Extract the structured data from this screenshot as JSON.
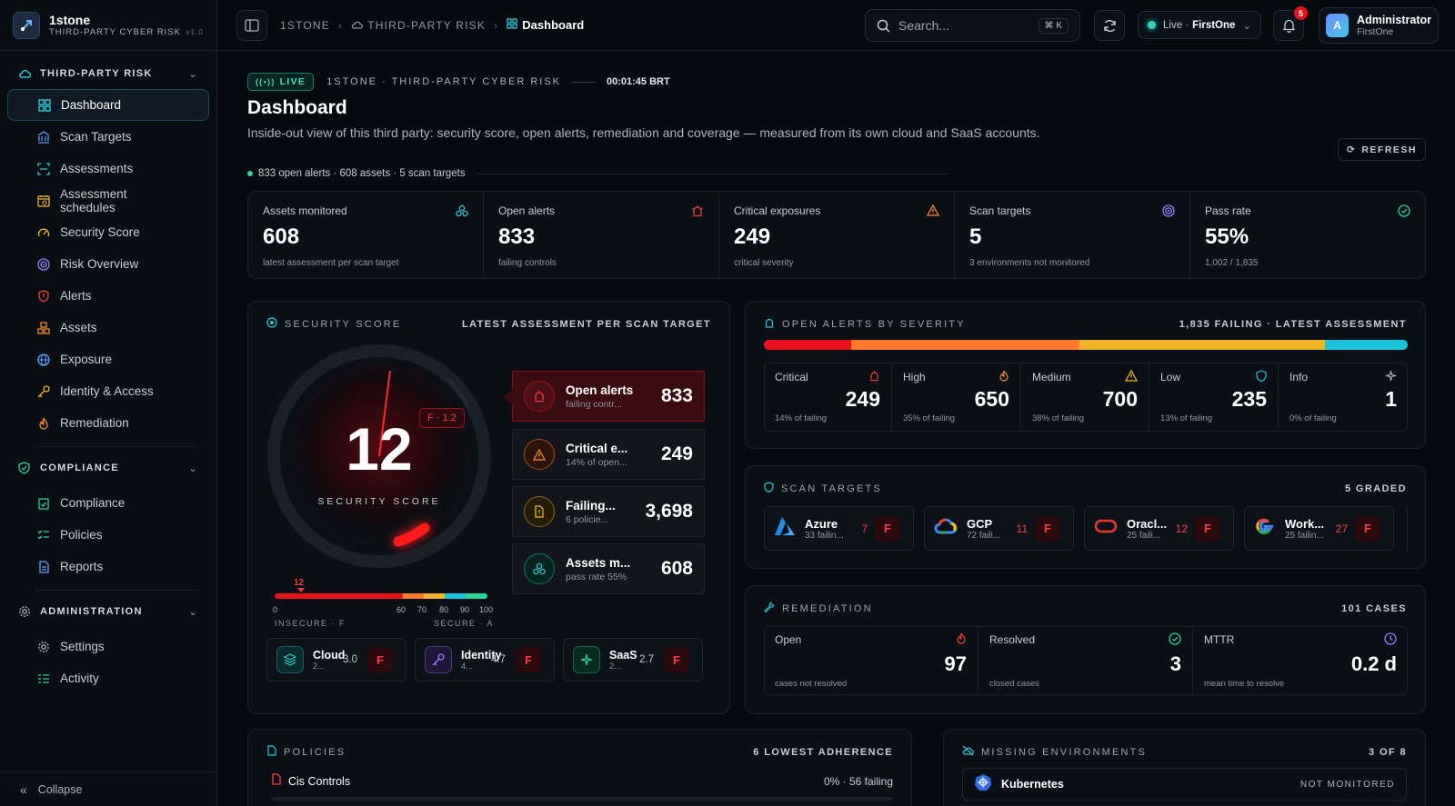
{
  "brand": {
    "name": "1stone",
    "subtitle": "THIRD-PARTY CYBER RISK",
    "version": "v1.0"
  },
  "sidebar": {
    "sections": [
      {
        "title": "THIRD-PARTY RISK",
        "items": [
          {
            "label": "Dashboard",
            "icon": "dashboard-icon",
            "active": true
          },
          {
            "label": "Scan Targets",
            "icon": "bank-icon"
          },
          {
            "label": "Assessments",
            "icon": "scan-icon"
          },
          {
            "label": "Assessment schedules",
            "icon": "calendar-clock-icon"
          },
          {
            "label": "Security Score",
            "icon": "gauge-icon"
          },
          {
            "label": "Risk Overview",
            "icon": "radar-icon"
          },
          {
            "label": "Alerts",
            "icon": "shield-alert-icon"
          },
          {
            "label": "Assets",
            "icon": "boxes-icon"
          },
          {
            "label": "Exposure",
            "icon": "globe-icon"
          },
          {
            "label": "Identity & Access",
            "icon": "key-icon"
          },
          {
            "label": "Remediation",
            "icon": "flame-icon"
          }
        ]
      },
      {
        "title": "COMPLIANCE",
        "items": [
          {
            "label": "Compliance",
            "icon": "clipboard-check-icon"
          },
          {
            "label": "Policies",
            "icon": "list-checks-icon"
          },
          {
            "label": "Reports",
            "icon": "file-text-icon"
          }
        ]
      },
      {
        "title": "ADMINISTRATION",
        "items": [
          {
            "label": "Settings",
            "icon": "gear-icon"
          },
          {
            "label": "Activity",
            "icon": "activity-list-icon"
          }
        ]
      }
    ],
    "collapse_label": "Collapse"
  },
  "topbar": {
    "breadcrumb": [
      "1STONE",
      "THIRD-PARTY RISK",
      "Dashboard"
    ],
    "search_placeholder": "Search...",
    "search_shortcut": "⌘ K",
    "env_status": "Live ·",
    "env_name": "FirstOne",
    "notifications": "5",
    "user_initial": "A",
    "user_name": "Administrator",
    "user_org": "FirstOne"
  },
  "header": {
    "live": "LIVE",
    "context": "1STONE · THIRD-PARTY CYBER RISK",
    "time": "00:01:45 BRT",
    "title": "Dashboard",
    "description": "Inside-out view of this third party: security score, open alerts, remediation and coverage — measured from its own cloud and SaaS accounts.",
    "stats": "833 open alerts · 608 assets · 5 scan targets",
    "refresh": "REFRESH"
  },
  "kpis": [
    {
      "label": "Assets monitored",
      "value": "608",
      "sub": "latest assessment per scan target",
      "icon": "boxes-icon",
      "color": "#2ec8d8"
    },
    {
      "label": "Open alerts",
      "value": "833",
      "sub": "failing controls",
      "icon": "siren-icon",
      "color": "#ff3b3b"
    },
    {
      "label": "Critical exposures",
      "value": "249",
      "sub": "critical severity",
      "icon": "warning-icon",
      "color": "#ff8a2a"
    },
    {
      "label": "Scan targets",
      "value": "5",
      "sub": "3 environments not monitored",
      "icon": "target-icon",
      "color": "#9a7dff"
    },
    {
      "label": "Pass rate",
      "value": "55%",
      "sub": "1,002 / 1,835",
      "icon": "check-circle-icon",
      "color": "#2ed39a"
    }
  ],
  "security_score": {
    "title": "SECURITY SCORE",
    "right": "LATEST ASSESSMENT PER SCAN TARGET",
    "score": "12",
    "score_label": "SECURITY SCORE",
    "grade": "F · 1.2",
    "bar_marker": "12",
    "ticks": [
      "0",
      "60",
      "70",
      "80",
      "90",
      "100"
    ],
    "insecure": "INSECURE · F",
    "secure": "SECURE · A",
    "metrics": [
      {
        "title": "Open alerts",
        "sub": "failing contr...",
        "value": "833"
      },
      {
        "title": "Critical e...",
        "sub": "14% of open...",
        "value": "249"
      },
      {
        "title": "Failing...",
        "sub": "6 policie...",
        "value": "3,698"
      },
      {
        "title": "Assets m...",
        "sub": "pass rate 55%",
        "value": "608"
      }
    ],
    "categories": [
      {
        "title": "Cloud",
        "sub": "2...",
        "score": "3.0",
        "grade": "F"
      },
      {
        "title": "Identity",
        "sub": "4...",
        "score": "4.7",
        "grade": "F"
      },
      {
        "title": "SaaS",
        "sub": "2...",
        "score": "2.7",
        "grade": "F"
      }
    ]
  },
  "severity": {
    "title": "OPEN ALERTS BY SEVERITY",
    "right": "1,835 FAILING · LATEST ASSESSMENT",
    "items": [
      {
        "label": "Critical",
        "value": "249",
        "sub": "14% of failing",
        "color": "#e8121c"
      },
      {
        "label": "High",
        "value": "650",
        "sub": "35% of failing",
        "color": "#ff7a2a"
      },
      {
        "label": "Medium",
        "value": "700",
        "sub": "38% of failing",
        "color": "#f0b429"
      },
      {
        "label": "Low",
        "value": "235",
        "sub": "13% of failing",
        "color": "#19c3dc"
      },
      {
        "label": "Info",
        "value": "1",
        "sub": "0% of failing",
        "color": "#8d98a5"
      }
    ]
  },
  "scan_targets": {
    "title": "SCAN TARGETS",
    "right": "5 GRADED",
    "items": [
      {
        "name": "Azure",
        "sub": "33 failin...",
        "count": "7",
        "grade": "F"
      },
      {
        "name": "GCP",
        "sub": "72 faili...",
        "count": "11",
        "grade": "F"
      },
      {
        "name": "Oracl...",
        "sub": "25 faili...",
        "count": "12",
        "grade": "F"
      },
      {
        "name": "Work...",
        "sub": "25 failin...",
        "count": "27",
        "grade": "F"
      }
    ]
  },
  "remediation": {
    "title": "REMEDIATION",
    "right": "101 CASES",
    "items": [
      {
        "label": "Open",
        "value": "97",
        "sub": "cases not resolved"
      },
      {
        "label": "Resolved",
        "value": "3",
        "sub": "closed cases"
      },
      {
        "label": "MTTR",
        "value": "0.2 d",
        "sub": "mean time to resolve"
      }
    ]
  },
  "policies": {
    "title": "POLICIES",
    "right": "6 LOWEST ADHERENCE",
    "first_name": "Cis Controls",
    "first_value": "0% · 56 failing"
  },
  "missing_env": {
    "title": "MISSING ENVIRONMENTS",
    "right": "3 OF 8",
    "first_name": "Kubernetes",
    "first_status": "NOT MONITORED"
  }
}
